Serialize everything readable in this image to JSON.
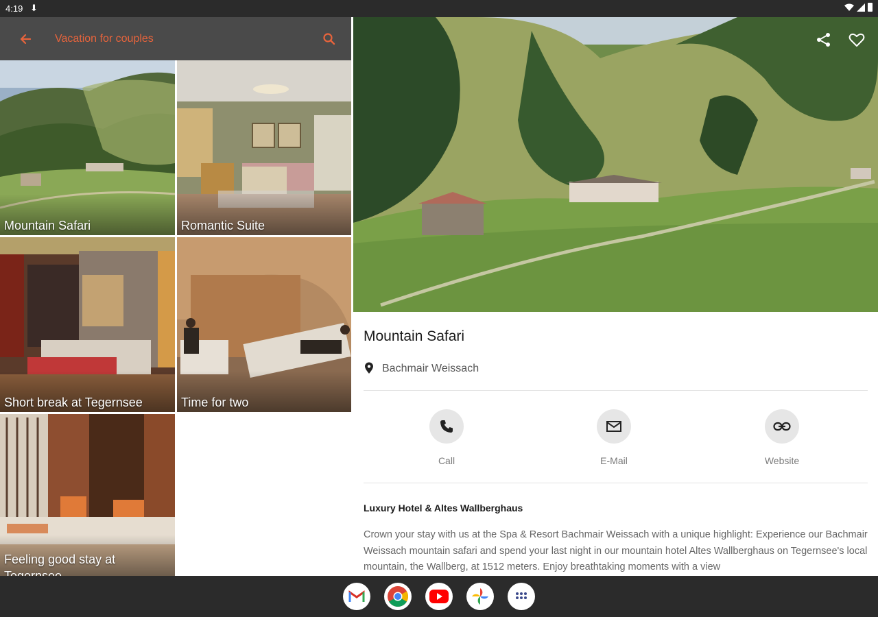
{
  "status": {
    "time": "4:19",
    "download_glyph": "⬇"
  },
  "app_bar": {
    "title": "Vacation for couples",
    "back_icon": "arrow-back-icon",
    "search_icon": "search-icon",
    "accent": "#e8643c"
  },
  "tiles": [
    {
      "label": "Mountain Safari"
    },
    {
      "label": "Romantic Suite"
    },
    {
      "label": "Short break at Tegernsee"
    },
    {
      "label": "Time for two"
    },
    {
      "label": "Feeling good stay at Tegernsee"
    }
  ],
  "detail": {
    "title": "Mountain Safari",
    "location": "Bachmair Weissach",
    "actions": [
      {
        "label": "Call",
        "icon": "phone-icon"
      },
      {
        "label": "E-Mail",
        "icon": "mail-icon"
      },
      {
        "label": "Website",
        "icon": "link-icon"
      }
    ],
    "subtitle": "Luxury Hotel & Altes Wallberghaus",
    "body": "Crown your stay with us at the Spa & Resort Bachmair Weissach with a unique highlight: Experience our Bachmair Weissach mountain safari and spend your last night in our mountain hotel Altes Wallberghaus on Tegernsee's local mountain, the Wallberg, at 1512 meters. Enjoy breathtaking moments with a view"
  },
  "dock": {
    "apps": [
      {
        "name": "Gmail",
        "glyph": "M"
      },
      {
        "name": "Chrome",
        "glyph": ""
      },
      {
        "name": "YouTube",
        "glyph": "▶"
      },
      {
        "name": "Photos",
        "glyph": ""
      },
      {
        "name": "App drawer",
        "glyph": ""
      }
    ]
  }
}
